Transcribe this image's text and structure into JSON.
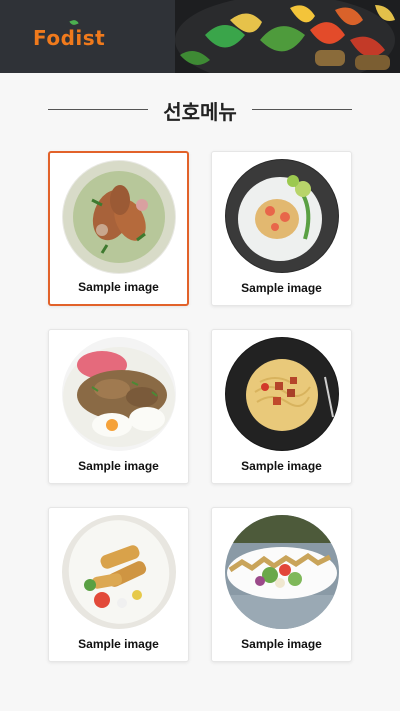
{
  "header": {
    "logo_text": "Fodist"
  },
  "section": {
    "title": "선호메뉴"
  },
  "menu": {
    "items": [
      {
        "caption": "Sample image",
        "selected": true
      },
      {
        "caption": "Sample image",
        "selected": false
      },
      {
        "caption": "Sample image",
        "selected": false
      },
      {
        "caption": "Sample image",
        "selected": false
      },
      {
        "caption": "Sample image",
        "selected": false
      },
      {
        "caption": "Sample image",
        "selected": false
      }
    ]
  },
  "colors": {
    "accent": "#e2622a",
    "logo": "#f07a1c",
    "header_bg": "#2f3237"
  }
}
